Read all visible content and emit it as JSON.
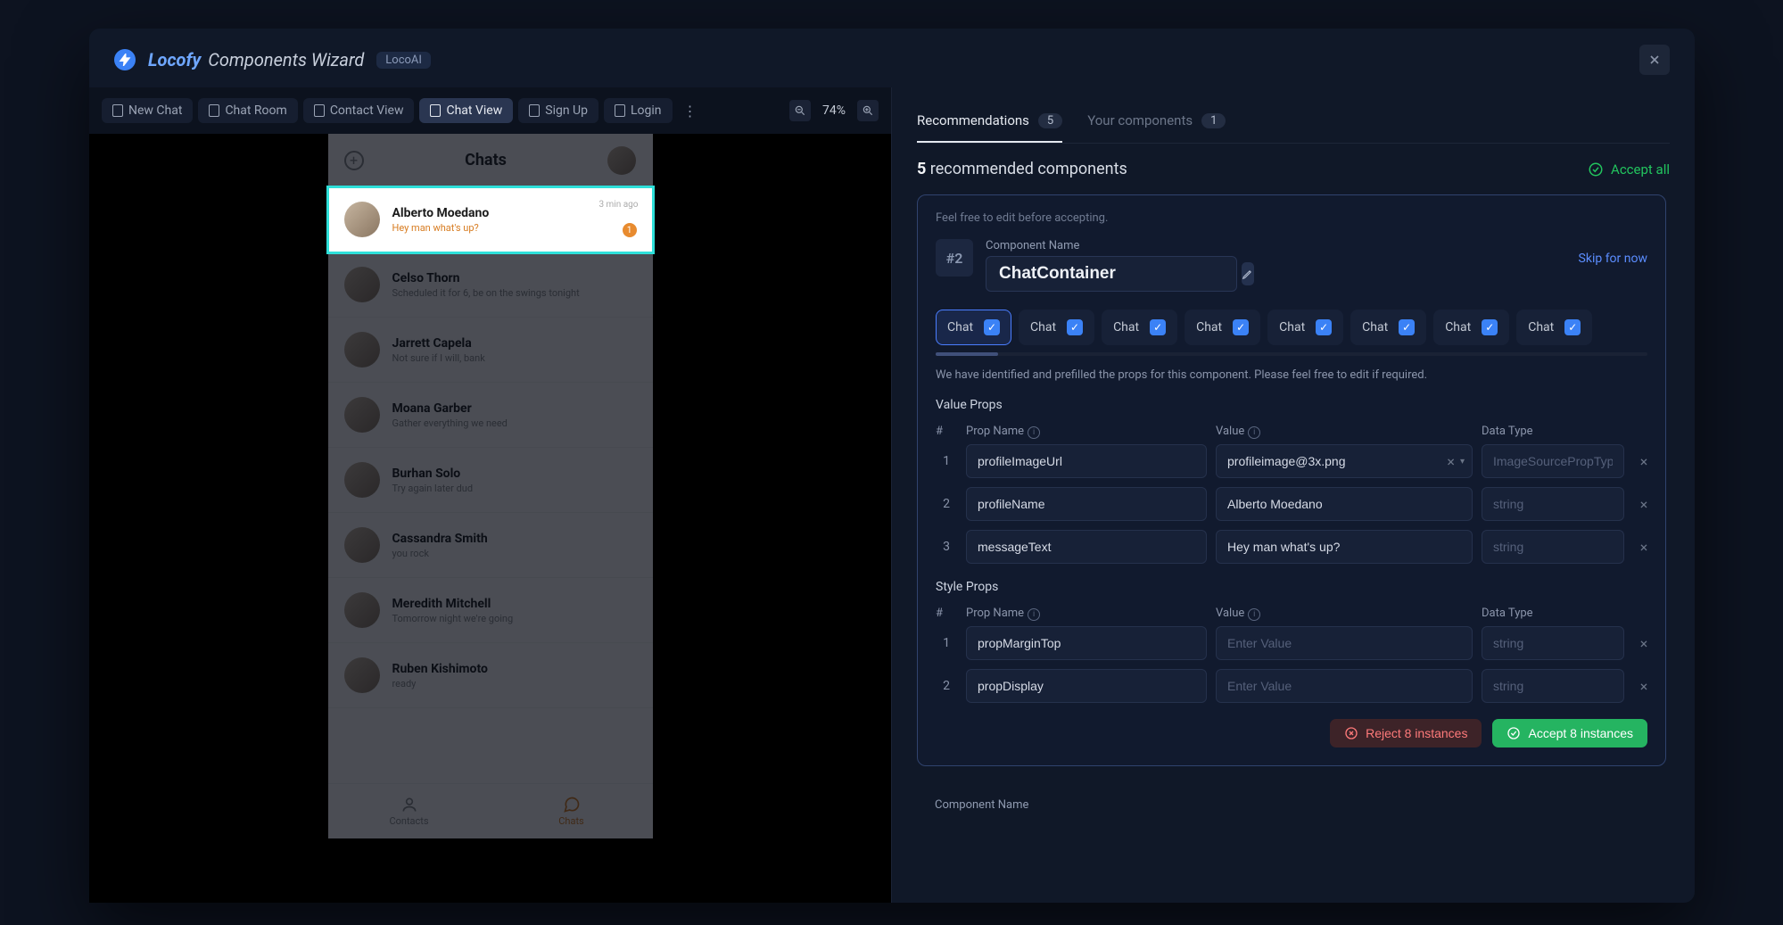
{
  "header": {
    "logo": "Locofy",
    "subtitle": "Components Wizard",
    "tag": "LocoAI"
  },
  "fileTabs": {
    "items": [
      {
        "label": "New Chat"
      },
      {
        "label": "Chat Room"
      },
      {
        "label": "Contact View"
      },
      {
        "label": "Chat View"
      },
      {
        "label": "Sign Up"
      },
      {
        "label": "Login"
      }
    ],
    "zoom": "74%"
  },
  "phone": {
    "title": "Chats",
    "chats": [
      {
        "name": "Alberto Moedano",
        "msg": "Hey man what's up?",
        "time": "3 min ago",
        "badge": "1"
      },
      {
        "name": "Celso Thorn",
        "msg": "Scheduled it for 6, be on the swings tonight",
        "time": ""
      },
      {
        "name": "Jarrett Capela",
        "msg": "Not sure if I will, bank",
        "time": ""
      },
      {
        "name": "Moana Garber",
        "msg": "Gather everything we need",
        "time": ""
      },
      {
        "name": "Burhan Solo",
        "msg": "Try again later dud",
        "time": ""
      },
      {
        "name": "Cassandra Smith",
        "msg": "you rock",
        "time": ""
      },
      {
        "name": "Meredith Mitchell",
        "msg": "Tomorrow night we're going",
        "time": ""
      },
      {
        "name": "Ruben Kishimoto",
        "msg": "ready",
        "time": ""
      }
    ],
    "nav": {
      "contacts": "Contacts",
      "chats": "Chats"
    }
  },
  "rightTabs": {
    "recommendations": {
      "label": "Recommendations",
      "count": "5"
    },
    "your": {
      "label": "Your components",
      "count": "1"
    }
  },
  "recLine": {
    "count": "5",
    "text": "recommended components"
  },
  "acceptAll": "Accept all",
  "card": {
    "hint": "Feel free to edit before accepting.",
    "index": "#2",
    "nameLabel": "Component Name",
    "name": "ChatContainer",
    "skip": "Skip for now",
    "variants": [
      {
        "label": "Chat"
      },
      {
        "label": "Chat"
      },
      {
        "label": "Chat"
      },
      {
        "label": "Chat"
      },
      {
        "label": "Chat"
      },
      {
        "label": "Chat"
      },
      {
        "label": "Chat"
      },
      {
        "label": "Chat"
      }
    ],
    "desc": "We have identified and prefilled the props for this component. Please feel free to edit if required.",
    "valueTitle": "Value Props",
    "styleTitle": "Style Props",
    "headers": {
      "num": "#",
      "name": "Prop Name",
      "value": "Value",
      "type": "Data Type"
    },
    "valueProps": [
      {
        "n": "1",
        "name": "profileImageUrl",
        "value": "profileimage@3x.png",
        "type": "ImageSourcePropType",
        "hasDropdown": true
      },
      {
        "n": "2",
        "name": "profileName",
        "value": "Alberto Moedano",
        "type": "string"
      },
      {
        "n": "3",
        "name": "messageText",
        "value": "Hey man what's up?",
        "type": "string"
      }
    ],
    "styleProps": [
      {
        "n": "1",
        "name": "propMarginTop",
        "value": "",
        "type": "string"
      },
      {
        "n": "2",
        "name": "propDisplay",
        "value": "",
        "type": "string"
      }
    ],
    "valuePlaceholder": "Enter Value",
    "reject": "Reject 8 instances",
    "accept": "Accept 8 instances"
  },
  "nextLabel": "Component Name"
}
